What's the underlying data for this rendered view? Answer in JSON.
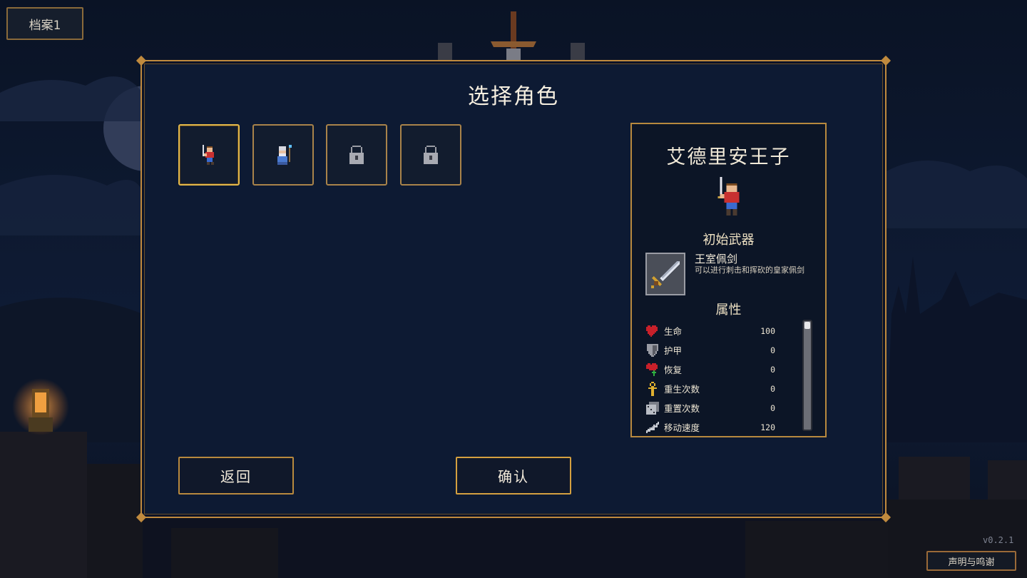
{
  "save_slot": {
    "label": "档案1"
  },
  "panel": {
    "title": "选择角色"
  },
  "characters": [
    {
      "name": "艾德里安王子",
      "icon": "prince-sprite-icon",
      "locked": false,
      "selected": true
    },
    {
      "name": "",
      "icon": "mage-sprite-icon",
      "locked": false,
      "selected": false
    },
    {
      "name": "",
      "icon": "lock-icon",
      "locked": true,
      "selected": false
    },
    {
      "name": "",
      "icon": "lock-icon",
      "locked": true,
      "selected": false
    }
  ],
  "details": {
    "name": "艾德里安王子",
    "starting_weapon_title": "初始武器",
    "weapon": {
      "name": "王室佩剑",
      "description": "可以进行刺击和挥砍的皇家佩剑",
      "icon": "sword-icon"
    },
    "attributes_title": "属性",
    "stats": [
      {
        "label": "生命",
        "value": "100",
        "icon": "heart-icon",
        "color": "#c8202a"
      },
      {
        "label": "护甲",
        "value": "0",
        "icon": "shield-icon",
        "color": "#9a9ca4"
      },
      {
        "label": "恢复",
        "value": "0",
        "icon": "heart-regen-icon",
        "color": "#c8202a"
      },
      {
        "label": "重生次数",
        "value": "0",
        "icon": "ankh-icon",
        "color": "#e0b030"
      },
      {
        "label": "重置次数",
        "value": "0",
        "icon": "dice-icon",
        "color": "#b8bcc4"
      },
      {
        "label": "移动速度",
        "value": "120",
        "icon": "wing-icon",
        "color": "#c8ccd4"
      }
    ]
  },
  "actions": {
    "back_label": "返回",
    "confirm_label": "确认"
  },
  "footer": {
    "version": "v0.2.1",
    "credits_label": "声明与鸣谢"
  },
  "colors": {
    "accent": "#c08a3e",
    "panel_bg": "#0d1a33",
    "selected_border": "#e3b84a"
  }
}
